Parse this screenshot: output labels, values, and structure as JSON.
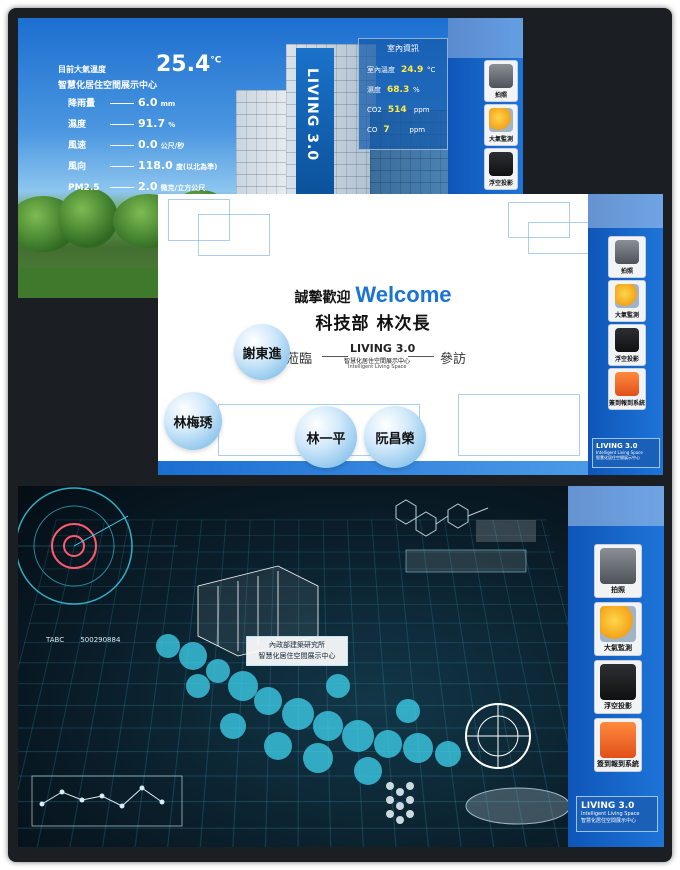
{
  "panel1": {
    "temp_label": "目前大氣溫度",
    "temp_value": "25.4",
    "temp_unit": "°C",
    "subtitle": "智慧化居住空間展示中心",
    "rows": [
      {
        "label": "降雨量",
        "value": "6.0",
        "unit": "mm"
      },
      {
        "label": "濕度",
        "value": "91.7",
        "unit": "%"
      },
      {
        "label": "風速",
        "value": "0.0",
        "unit": "公尺/秒"
      },
      {
        "label": "風向",
        "value": "118.0",
        "unit": "度(以北為準)"
      },
      {
        "label": "PM2.5",
        "value": "2.0",
        "unit": "微克/立方公尺"
      }
    ],
    "building_text": "LIVING 3.0",
    "indoor_title": "室內資訊",
    "indoor_rows": [
      {
        "label": "室內溫度",
        "value": "24.9",
        "unit": "°C"
      },
      {
        "label": "濕度",
        "value": "68.3",
        "unit": "%"
      },
      {
        "label": "CO2",
        "value": "514",
        "unit": "ppm"
      },
      {
        "label": "CO",
        "value": "7",
        "unit": "ppm"
      }
    ],
    "sidebar": [
      {
        "label": "拍照",
        "icon": "camera-icon"
      },
      {
        "label": "大氣監測",
        "icon": "weather-icon"
      },
      {
        "label": "浮空投影",
        "icon": "projector-icon"
      }
    ]
  },
  "panel2": {
    "welcome_cn": "誠摯歡迎",
    "welcome_en": "Welcome",
    "dept": "科技部 林次長",
    "visit_left": "蒞臨",
    "visit_right": "參訪",
    "logo_main": "LIVING 3.0",
    "logo_cn": "智慧化居住空間展示中心",
    "logo_en": "Intelligent Living Space",
    "names": [
      "謝東進",
      "林梅琇",
      "林一平",
      "阮昌榮"
    ],
    "sidebar": [
      {
        "label": "拍照",
        "icon": "camera-icon"
      },
      {
        "label": "大氣監測",
        "icon": "weather-icon"
      },
      {
        "label": "浮空投影",
        "icon": "projector-icon"
      },
      {
        "label": "簽到報到系統",
        "icon": "calendar-icon"
      }
    ],
    "brand_main": "LIVING 3.0",
    "brand_en": "Intelligent Living Space",
    "brand_cn": "智慧化居住空間展示中心"
  },
  "panel3": {
    "label_line1": "內政部建築研究所",
    "label_line2": "智慧化居住空間展示中心",
    "code_text": "500290884",
    "tabc": "TABC",
    "sidebar": [
      {
        "label": "拍照",
        "icon": "camera-icon"
      },
      {
        "label": "大氣監測",
        "icon": "weather-icon"
      },
      {
        "label": "浮空投影",
        "icon": "projector-icon"
      },
      {
        "label": "簽到報到系統",
        "icon": "calendar-icon"
      }
    ],
    "brand_main": "LIVING 3.0",
    "brand_en": "Intelligent Living Space",
    "brand_cn": "智慧化居住空間展示中心"
  },
  "colors": {
    "accent": "#1a74d6",
    "value_yellow": "#ffe94a",
    "hud_cyan": "#3fd4f0"
  }
}
